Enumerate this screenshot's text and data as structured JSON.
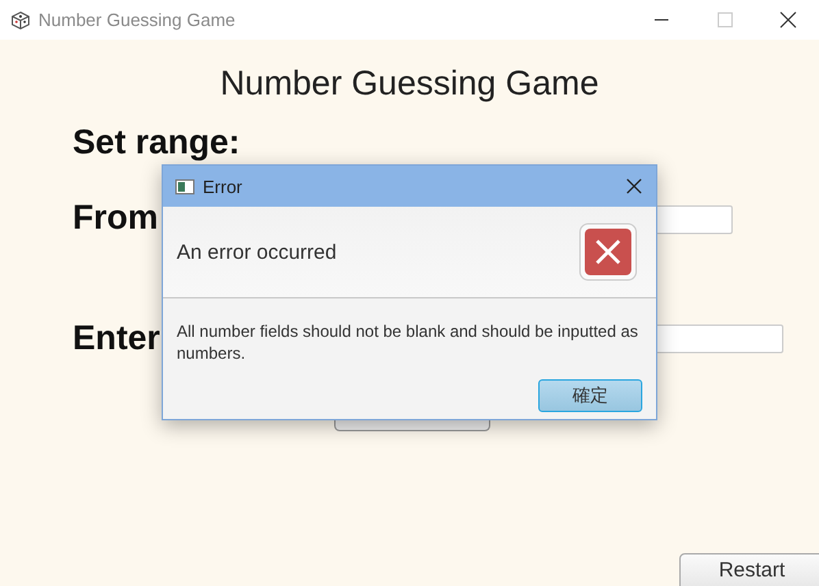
{
  "window": {
    "title": "Number Guessing Game"
  },
  "game": {
    "heading": "Number Guessing Game",
    "range_label": "Set range:",
    "from_label": "From",
    "guess_label": "Enter",
    "restart_button": "Restart"
  },
  "dialog": {
    "title": "Error",
    "header": "An error occurred",
    "message": "All number fields should not be blank and should be inputted as numbers.",
    "ok_button": "確定"
  }
}
